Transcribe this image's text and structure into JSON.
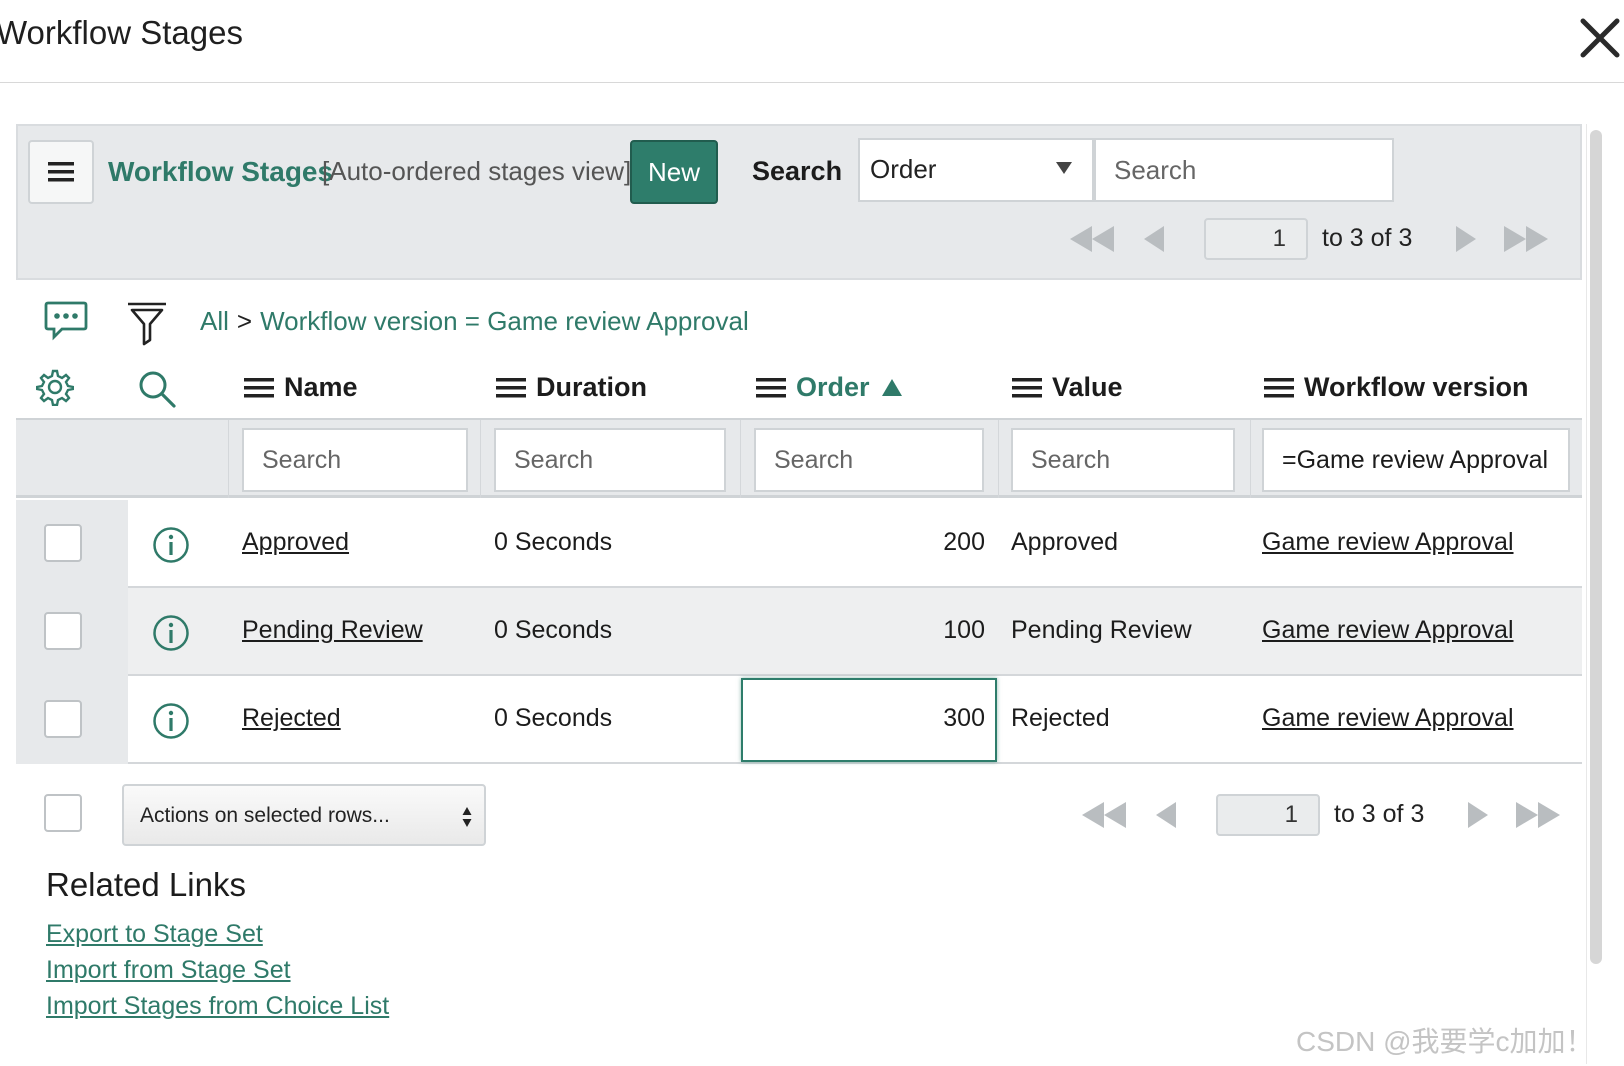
{
  "modal": {
    "title": "Workflow Stages"
  },
  "list": {
    "title": "Workflow Stages",
    "view": "[Auto-ordered stages view]",
    "new_label": "New",
    "search_label": "Search",
    "search_field": "Order",
    "search_placeholder": "Search"
  },
  "pager_top": {
    "page": "1",
    "range": "to 3 of 3"
  },
  "pager_bottom": {
    "page": "1",
    "range": "to 3 of 3"
  },
  "breadcrumb": {
    "all": "All",
    "separator": ">",
    "condition": "Workflow version = Game review Approval"
  },
  "columns": [
    {
      "label": "Name"
    },
    {
      "label": "Duration"
    },
    {
      "label": "Order",
      "sorted": "ascending"
    },
    {
      "label": "Value"
    },
    {
      "label": "Workflow version"
    }
  ],
  "filters": {
    "name_placeholder": "Search",
    "duration_placeholder": "Search",
    "order_placeholder": "Search",
    "value_placeholder": "Search",
    "workflow_version_value": "=Game review Approval"
  },
  "rows": [
    {
      "name": "Approved",
      "duration": "0 Seconds",
      "order": "200",
      "value": "Approved",
      "workflow_version": "Game review Approval"
    },
    {
      "name": "Pending Review",
      "duration": "0 Seconds",
      "order": "100",
      "value": "Pending Review",
      "workflow_version": "Game review Approval"
    },
    {
      "name": "Rejected",
      "duration": "0 Seconds",
      "order": "300",
      "value": "Rejected",
      "workflow_version": "Game review Approval"
    }
  ],
  "actions": {
    "label": "Actions on selected rows..."
  },
  "related_links": {
    "title": "Related Links",
    "items": [
      "Export to Stage Set",
      "Import from Stage Set",
      "Import Stages from Choice List"
    ]
  },
  "watermark": "CSDN @我要学c加加！",
  "colors": {
    "accent": "#2e7d6b",
    "link": "#2f7a69",
    "header_bg": "#e7e9eb"
  },
  "icons": [
    "close-icon",
    "menu-icon",
    "comments-icon",
    "filter-icon",
    "settings-gear-icon",
    "search-icon",
    "info-icon",
    "first-page-icon",
    "prev-page-icon",
    "next-page-icon",
    "last-page-icon",
    "sort-ascending-icon"
  ]
}
